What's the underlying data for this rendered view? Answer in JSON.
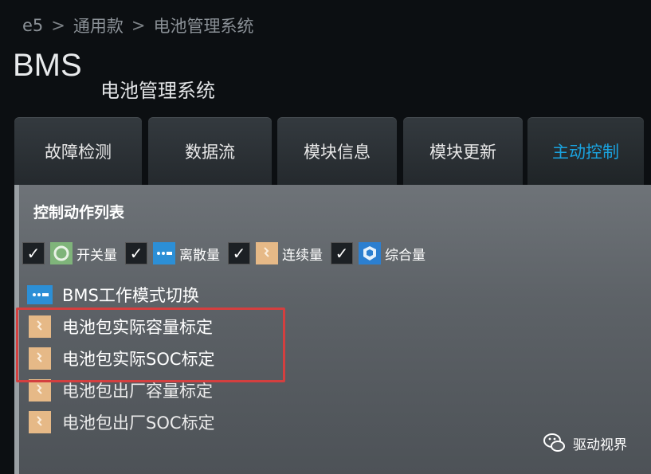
{
  "breadcrumb": {
    "root": "e5",
    "level1": "通用款",
    "level2": "电池管理系统",
    "separator": ">"
  },
  "app": {
    "title": "BMS",
    "subtitle": "电池管理系统"
  },
  "tabs": [
    {
      "label": "故障检测",
      "active": false
    },
    {
      "label": "数据流",
      "active": false
    },
    {
      "label": "模块信息",
      "active": false
    },
    {
      "label": "模块更新",
      "active": false
    },
    {
      "label": "主动控制",
      "active": true
    }
  ],
  "panel": {
    "title": "控制动作列表",
    "filters": [
      {
        "label": "开关量",
        "checked": true,
        "icon": "switch-icon",
        "color": "#7fb47a"
      },
      {
        "label": "离散量",
        "checked": true,
        "icon": "discrete-icon",
        "color": "#2c8fd6"
      },
      {
        "label": "连续量",
        "checked": true,
        "icon": "continuous-icon",
        "color": "#e6b987"
      },
      {
        "label": "综合量",
        "checked": true,
        "icon": "composite-icon",
        "color": "#2c7fd0"
      }
    ],
    "actions": [
      {
        "label": "BMS工作模式切换",
        "icon": "discrete-icon"
      },
      {
        "label": "电池包实际容量标定",
        "icon": "continuous-icon"
      },
      {
        "label": "电池包实际SOC标定",
        "icon": "continuous-icon"
      },
      {
        "label": "电池包出厂容量标定",
        "icon": "continuous-icon"
      },
      {
        "label": "电池包出厂SOC标定",
        "icon": "continuous-icon"
      }
    ]
  },
  "watermark": {
    "text": "驱动视界",
    "icon": "wechat-icon"
  },
  "colors": {
    "accent": "#1aa3e0",
    "highlight": "#d43f3f"
  }
}
